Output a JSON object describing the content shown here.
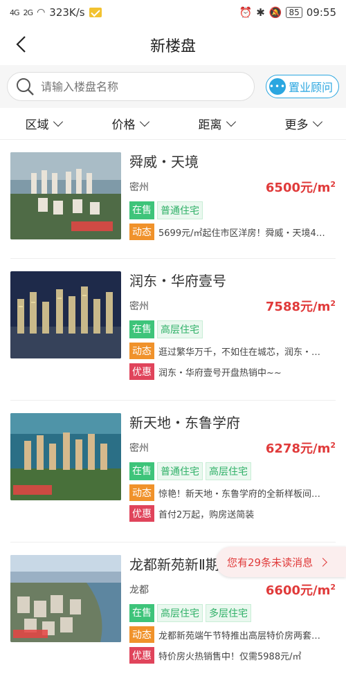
{
  "status_bar": {
    "signal1": "4G",
    "signal2": "2G",
    "speed": "323K/s",
    "battery": "85",
    "time": "09:55"
  },
  "header": {
    "title": "新楼盘"
  },
  "search": {
    "placeholder": "请输入楼盘名称",
    "consult_label": "置业顾问"
  },
  "filters": [
    "区域",
    "价格",
    "距离",
    "更多"
  ],
  "listings": [
    {
      "name": "舜威・天境",
      "district": "密州",
      "price": "6500元/m",
      "price_sup": "2",
      "status": "在售",
      "types": [
        "普通住宅"
      ],
      "dynamic_label": "动态",
      "dynamic": "5699元/㎡起住市区洋房！舜威・天境4…",
      "promo_label": "",
      "promo": ""
    },
    {
      "name": "润东・华府壹号",
      "district": "密州",
      "price": "7588元/m",
      "price_sup": "2",
      "status": "在售",
      "types": [
        "高层住宅"
      ],
      "dynamic_label": "动态",
      "dynamic": "逛过繁华万千，不如住在城芯，润东・…",
      "promo_label": "优惠",
      "promo": "润东・华府壹号开盘热销中~~"
    },
    {
      "name": "新天地・东鲁学府",
      "district": "密州",
      "price": "6278元/m",
      "price_sup": "2",
      "status": "在售",
      "types": [
        "普通住宅",
        "高层住宅"
      ],
      "dynamic_label": "动态",
      "dynamic": "惊艳！新天地・东鲁学府的全新样板间…",
      "promo_label": "优惠",
      "promo": "首付2万起，购房送简装"
    },
    {
      "name": "龙都新苑新Ⅱ期",
      "district": "龙都",
      "price": "6600元/m",
      "price_sup": "2",
      "status": "在售",
      "types": [
        "高层住宅",
        "多层住宅"
      ],
      "dynamic_label": "动态",
      "dynamic": "龙都新苑端午节特推出高层特价房两套…",
      "promo_label": "优惠",
      "promo": "特价房火热销售中！仅需5988元/㎡"
    }
  ],
  "notice": {
    "text": "您有29条未读消息"
  },
  "colors": {
    "accent_blue": "#2aa6e0",
    "price_red": "#e03a3a",
    "sale_green": "#3ec47a",
    "dynamic_orange": "#f0922b",
    "promo_red": "#e0445b"
  }
}
